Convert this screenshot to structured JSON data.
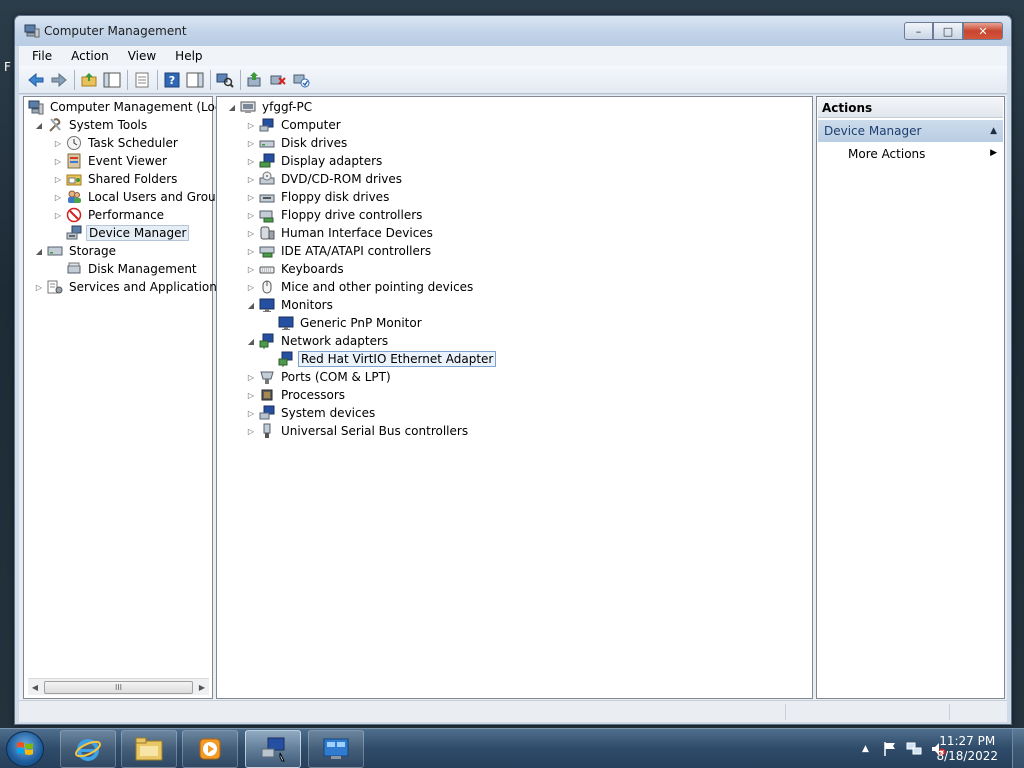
{
  "desktop": {
    "edge_text": "F"
  },
  "window": {
    "title": "Computer Management",
    "buttons": {
      "minimize": "–",
      "maximize": "□",
      "close": "✕"
    }
  },
  "menu": [
    "File",
    "Action",
    "View",
    "Help"
  ],
  "left_tree": [
    {
      "label": "Computer Management (Local",
      "icon": "computer-management-icon",
      "level": 0,
      "expander": ""
    },
    {
      "label": "System Tools",
      "icon": "system-tools-icon",
      "level": 1,
      "expander": "open"
    },
    {
      "label": "Task Scheduler",
      "icon": "task-scheduler-icon",
      "level": 2,
      "expander": "closed"
    },
    {
      "label": "Event Viewer",
      "icon": "event-viewer-icon",
      "level": 2,
      "expander": "closed"
    },
    {
      "label": "Shared Folders",
      "icon": "shared-folders-icon",
      "level": 2,
      "expander": "closed"
    },
    {
      "label": "Local Users and Groups",
      "icon": "local-users-icon",
      "level": 2,
      "expander": "closed"
    },
    {
      "label": "Performance",
      "icon": "performance-icon",
      "level": 2,
      "expander": "closed"
    },
    {
      "label": "Device Manager",
      "icon": "device-manager-icon",
      "level": 2,
      "expander": "",
      "selected": true
    },
    {
      "label": "Storage",
      "icon": "storage-icon",
      "level": 1,
      "expander": "open"
    },
    {
      "label": "Disk Management",
      "icon": "disk-management-icon",
      "level": 2,
      "expander": ""
    },
    {
      "label": "Services and Applications",
      "icon": "services-icon",
      "level": 1,
      "expander": "closed"
    }
  ],
  "scrollbar": {
    "left": "◀",
    "right": "▶",
    "grip": "III"
  },
  "device_tree": [
    {
      "label": "yfggf-PC",
      "icon": "pc-icon",
      "level": 0,
      "expander": "open"
    },
    {
      "label": "Computer",
      "icon": "computer-icon",
      "level": 1,
      "expander": "closed"
    },
    {
      "label": "Disk drives",
      "icon": "disk-drive-icon",
      "level": 1,
      "expander": "closed"
    },
    {
      "label": "Display adapters",
      "icon": "display-adapter-icon",
      "level": 1,
      "expander": "closed"
    },
    {
      "label": "DVD/CD-ROM drives",
      "icon": "dvd-icon",
      "level": 1,
      "expander": "closed"
    },
    {
      "label": "Floppy disk drives",
      "icon": "floppy-icon",
      "level": 1,
      "expander": "closed"
    },
    {
      "label": "Floppy drive controllers",
      "icon": "floppy-controller-icon",
      "level": 1,
      "expander": "closed"
    },
    {
      "label": "Human Interface Devices",
      "icon": "hid-icon",
      "level": 1,
      "expander": "closed"
    },
    {
      "label": "IDE ATA/ATAPI controllers",
      "icon": "ide-icon",
      "level": 1,
      "expander": "closed"
    },
    {
      "label": "Keyboards",
      "icon": "keyboard-icon",
      "level": 1,
      "expander": "closed"
    },
    {
      "label": "Mice and other pointing devices",
      "icon": "mouse-icon",
      "level": 1,
      "expander": "closed"
    },
    {
      "label": "Monitors",
      "icon": "monitor-icon",
      "level": 1,
      "expander": "open"
    },
    {
      "label": "Generic PnP Monitor",
      "icon": "monitor-icon",
      "level": 2,
      "expander": ""
    },
    {
      "label": "Network adapters",
      "icon": "network-adapter-icon",
      "level": 1,
      "expander": "open"
    },
    {
      "label": "Red Hat VirtIO Ethernet Adapter",
      "icon": "network-adapter-icon",
      "level": 2,
      "expander": "",
      "focused": true
    },
    {
      "label": "Ports (COM & LPT)",
      "icon": "port-icon",
      "level": 1,
      "expander": "closed"
    },
    {
      "label": "Processors",
      "icon": "processor-icon",
      "level": 1,
      "expander": "closed"
    },
    {
      "label": "System devices",
      "icon": "system-devices-icon",
      "level": 1,
      "expander": "closed"
    },
    {
      "label": "Universal Serial Bus controllers",
      "icon": "usb-icon",
      "level": 1,
      "expander": "closed"
    }
  ],
  "actions": {
    "header": "Actions",
    "section": "Device Manager",
    "items": [
      "More Actions"
    ]
  },
  "taskbar": {
    "apps": [
      "internet-explorer-icon",
      "file-explorer-icon",
      "media-player-icon",
      "computer-management-icon",
      "control-panel-icon"
    ],
    "time": "11:27 PM",
    "date": "8/18/2022"
  }
}
